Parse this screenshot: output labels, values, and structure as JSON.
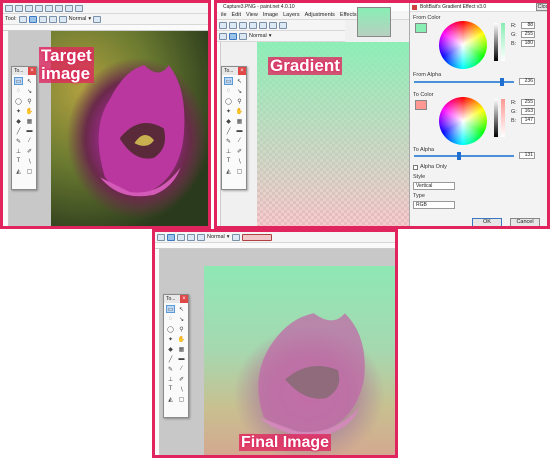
{
  "panel_target": {
    "toolbar_label": "Tool:",
    "blend_mode": "Normal",
    "caption": "Target image",
    "caption_line1": "Target",
    "caption_line2": "image",
    "tools_title": "To..."
  },
  "panel_gradient": {
    "window_title": "Capture3.PNG - paint.net 4.0.10",
    "menu": [
      "ile",
      "Edit",
      "View",
      "Image",
      "Layers",
      "Adjustments",
      "Effects"
    ],
    "blend_mode": "Normal",
    "caption": "Gradient",
    "tools_title": "To..."
  },
  "dialog": {
    "title": "BoltBait's Gradient Effect v3.0",
    "close_label": "Clos",
    "from_color_label": "From Color",
    "from_color": "#88eeb4",
    "from_rgb": {
      "r": "88",
      "g": "255",
      "b": "180"
    },
    "from_alpha_label": "From Alpha",
    "from_alpha": "236",
    "to_color_label": "To Color",
    "to_color": "#ff9893",
    "to_rgb": {
      "r": "255",
      "g": "163",
      "b": "147"
    },
    "to_alpha_label": "To Alpha",
    "to_alpha": "131",
    "alpha_only_label": "Alpha Only",
    "style_label": "Style",
    "style_value": "Vertical",
    "type_label": "Type",
    "type_value": "RGB",
    "ok_label": "OK",
    "cancel_label": "Cancel",
    "r_label": "R:",
    "g_label": "G:",
    "b_label": "B:"
  },
  "panel_final": {
    "blend_mode": "Normal",
    "caption": "Final Image",
    "tools_title": "To..."
  },
  "colors": {
    "border": "#e0245e",
    "gradient_top": "#88eeb4",
    "gradient_bottom": "#f4a0a8"
  }
}
